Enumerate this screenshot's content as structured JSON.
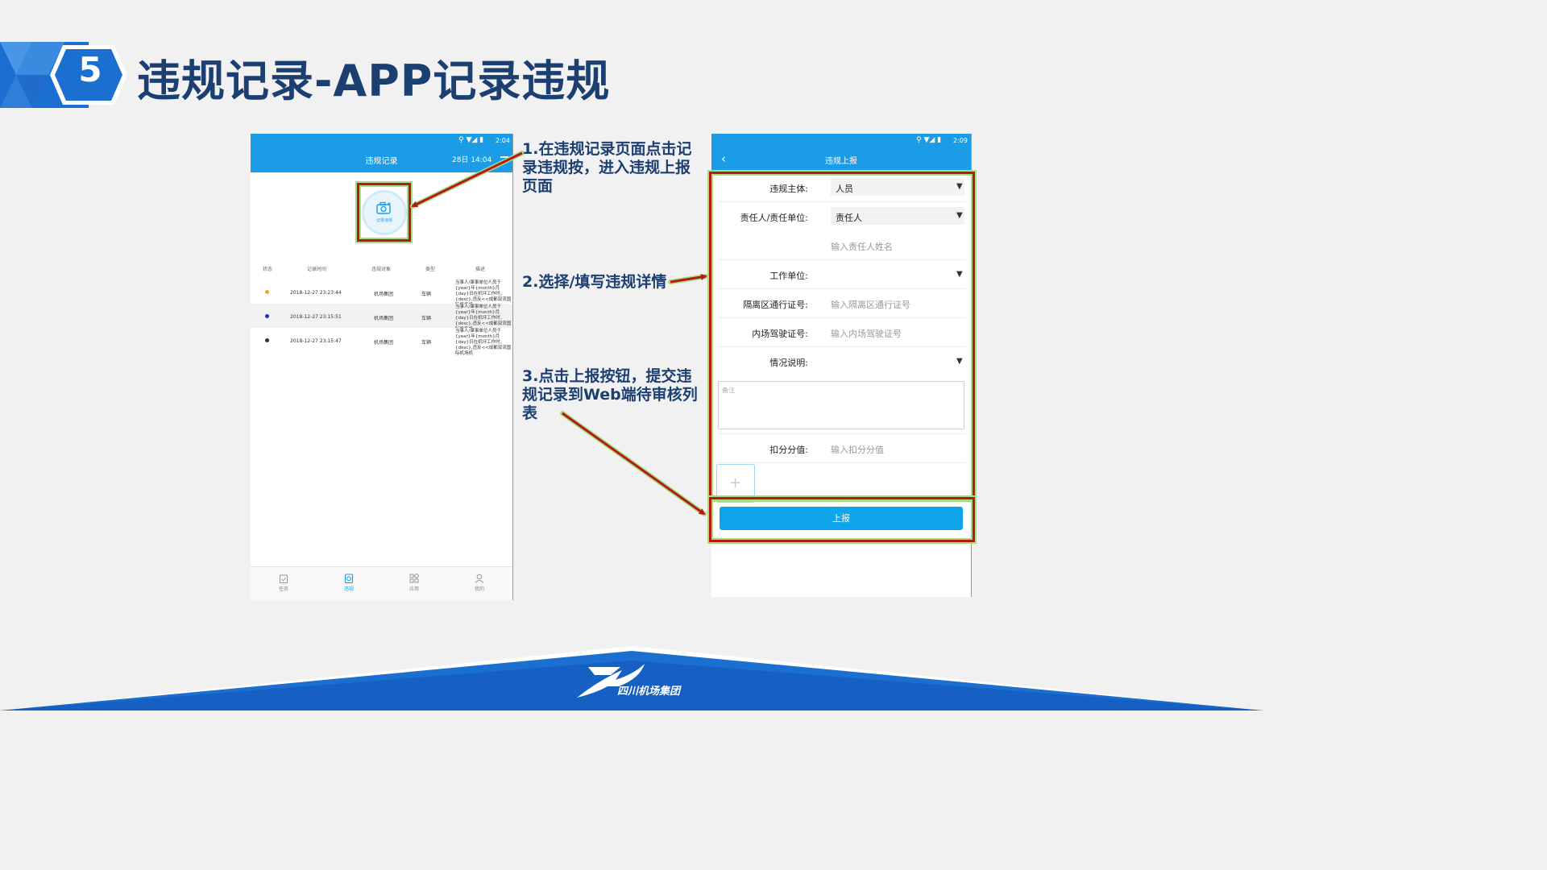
{
  "slide": {
    "number": "5",
    "title": "违规记录-APP记录违规",
    "logo_text": "四川机场集团"
  },
  "annotations": {
    "step1": "1.在违规记录页面点击记录违规按，进入违规上报页面",
    "step2": "2.选择/填写违规详情",
    "step3": "3.点击上报按钮，提交违规记录到Web端待审核列表"
  },
  "left_phone": {
    "status_time": "2:04",
    "title": "违规记录",
    "date": "28日 14:04",
    "record_button": "记录违规",
    "table": {
      "headers": [
        "状态",
        "记录时间",
        "违规对象",
        "类型",
        "描述"
      ],
      "rows": [
        {
          "color": "#f5a623",
          "time": "2018-12-27 23:23:44",
          "target": "机场集团",
          "type": "车辆",
          "desc": "当事人/肇事单位人员于{year}年{month}月{day}日在机坪工作时，{desc},违反<<成都双流国际机场机"
        },
        {
          "color": "#1f2ad1",
          "time": "2018-12-27 23:15:51",
          "target": "机场集团",
          "type": "车辆",
          "desc": "当事人/肇事单位人员于{year}年{month}月{day}日在机坪工作时，{desc},违反<<成都双流国际机场机"
        },
        {
          "color": "#333333",
          "time": "2018-12-27 23:15:47",
          "target": "机场集团",
          "type": "车辆",
          "desc": "当事人/肇事单位人员于{year}年{month}月{day}日在机坪工作时，{desc},违反<<成都双流国际机场机"
        }
      ]
    },
    "nav": [
      "任务",
      "违规",
      "应用",
      "我的"
    ],
    "nav_active": "违规"
  },
  "right_phone": {
    "status_time": "2:09",
    "title": "违规上报",
    "fields": {
      "subject_label": "违规主体:",
      "subject_value": "人员",
      "responsible_label": "责任人/责任单位:",
      "responsible_value": "责任人",
      "responsible_name_placeholder": "输入责任人姓名",
      "work_unit_label": "工作单位:",
      "pass_label": "隔离区通行证号:",
      "pass_placeholder": "输入隔离区通行证号",
      "license_label": "内场驾驶证号:",
      "license_placeholder": "输入内场驾驶证号",
      "situation_label": "情况说明:",
      "remark_placeholder": "备注",
      "points_label": "扣分分值:",
      "points_placeholder": "输入扣分分值"
    },
    "submit": "上报"
  },
  "colors": {
    "accent": "#1a9ce6",
    "title": "#1c3f72",
    "highlight_border": "#b51a1a",
    "footer": "#1a6fd0"
  }
}
